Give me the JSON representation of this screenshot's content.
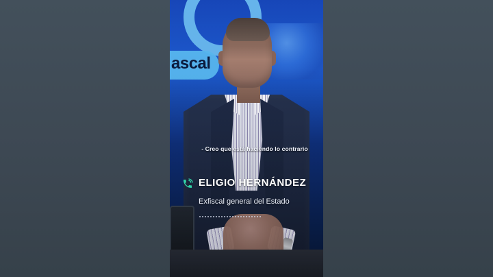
{
  "video": {
    "brand_text": "ascal",
    "caption": "- Creo que está haciendo lo contrario"
  },
  "lower_third": {
    "name": "ELIGIO HERNÁNDEZ",
    "title": "Exfiscal general del Estado"
  },
  "icons": {
    "phone": "phone-icon"
  },
  "colors": {
    "accent": "#31d2a8",
    "text": "#ffffff",
    "background": "#3d4a56",
    "studio_blue": "#1d5bd0"
  }
}
